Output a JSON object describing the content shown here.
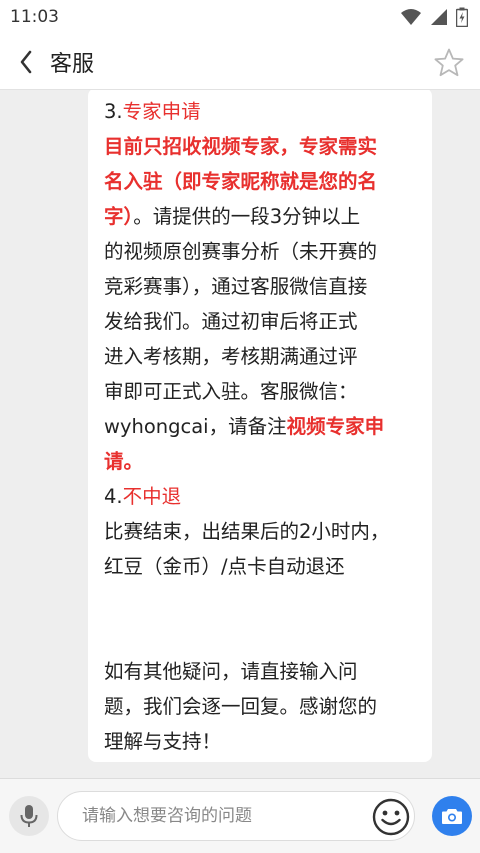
{
  "status_bar": {
    "time": "11:03"
  },
  "header": {
    "title": "客服"
  },
  "message": {
    "lines": [
      [
        {
          "t": "3.",
          "s": "normal"
        },
        {
          "t": "专家申请",
          "s": "red"
        }
      ],
      [
        {
          "t": "目前只招收视频专家，专家需实",
          "s": "red-bold"
        }
      ],
      [
        {
          "t": "名入驻（即专家昵称就是您的名",
          "s": "red-bold"
        }
      ],
      [
        {
          "t": "字）",
          "s": "red-bold"
        },
        {
          "t": "。请提供的一段3分钟以上",
          "s": "normal"
        }
      ],
      [
        {
          "t": "的视频原创赛事分析（未开赛的",
          "s": "normal"
        }
      ],
      [
        {
          "t": "竞彩赛事），通过客服微信直接",
          "s": "normal"
        }
      ],
      [
        {
          "t": "发给我们。通过初审后将正式",
          "s": "normal"
        }
      ],
      [
        {
          "t": "进入考核期，考核期满通过评",
          "s": "normal"
        }
      ],
      [
        {
          "t": "审即可正式入驻。客服微信：",
          "s": "normal"
        }
      ],
      [
        {
          "t": "wyhongcai，请备注",
          "s": "normal"
        },
        {
          "t": "视频专家申",
          "s": "red-bold"
        }
      ],
      [
        {
          "t": "请。",
          "s": "red-bold"
        }
      ],
      [
        {
          "t": "4.",
          "s": "normal"
        },
        {
          "t": "不中退",
          "s": "red"
        }
      ],
      [
        {
          "t": "比赛结束，出结果后的2小时内，",
          "s": "normal"
        }
      ],
      [
        {
          "t": "红豆（金币）/点卡自动退还",
          "s": "normal"
        }
      ],
      "gap",
      [
        {
          "t": "如有其他疑问，请直接输入问",
          "s": "normal"
        }
      ],
      [
        {
          "t": "题，我们会逐一回复。感谢您的",
          "s": "normal"
        }
      ],
      [
        {
          "t": "理解与支持！",
          "s": "normal"
        }
      ]
    ]
  },
  "input_bar": {
    "placeholder": "请输入想要咨询的问题"
  },
  "icons": {
    "back": "chevron-left-icon",
    "favorite": "star-outline-icon",
    "voice": "microphone-icon",
    "emoji": "smiley-icon",
    "camera": "camera-icon"
  },
  "colors": {
    "highlight": "#e8302e",
    "accent": "#2f80ed"
  }
}
